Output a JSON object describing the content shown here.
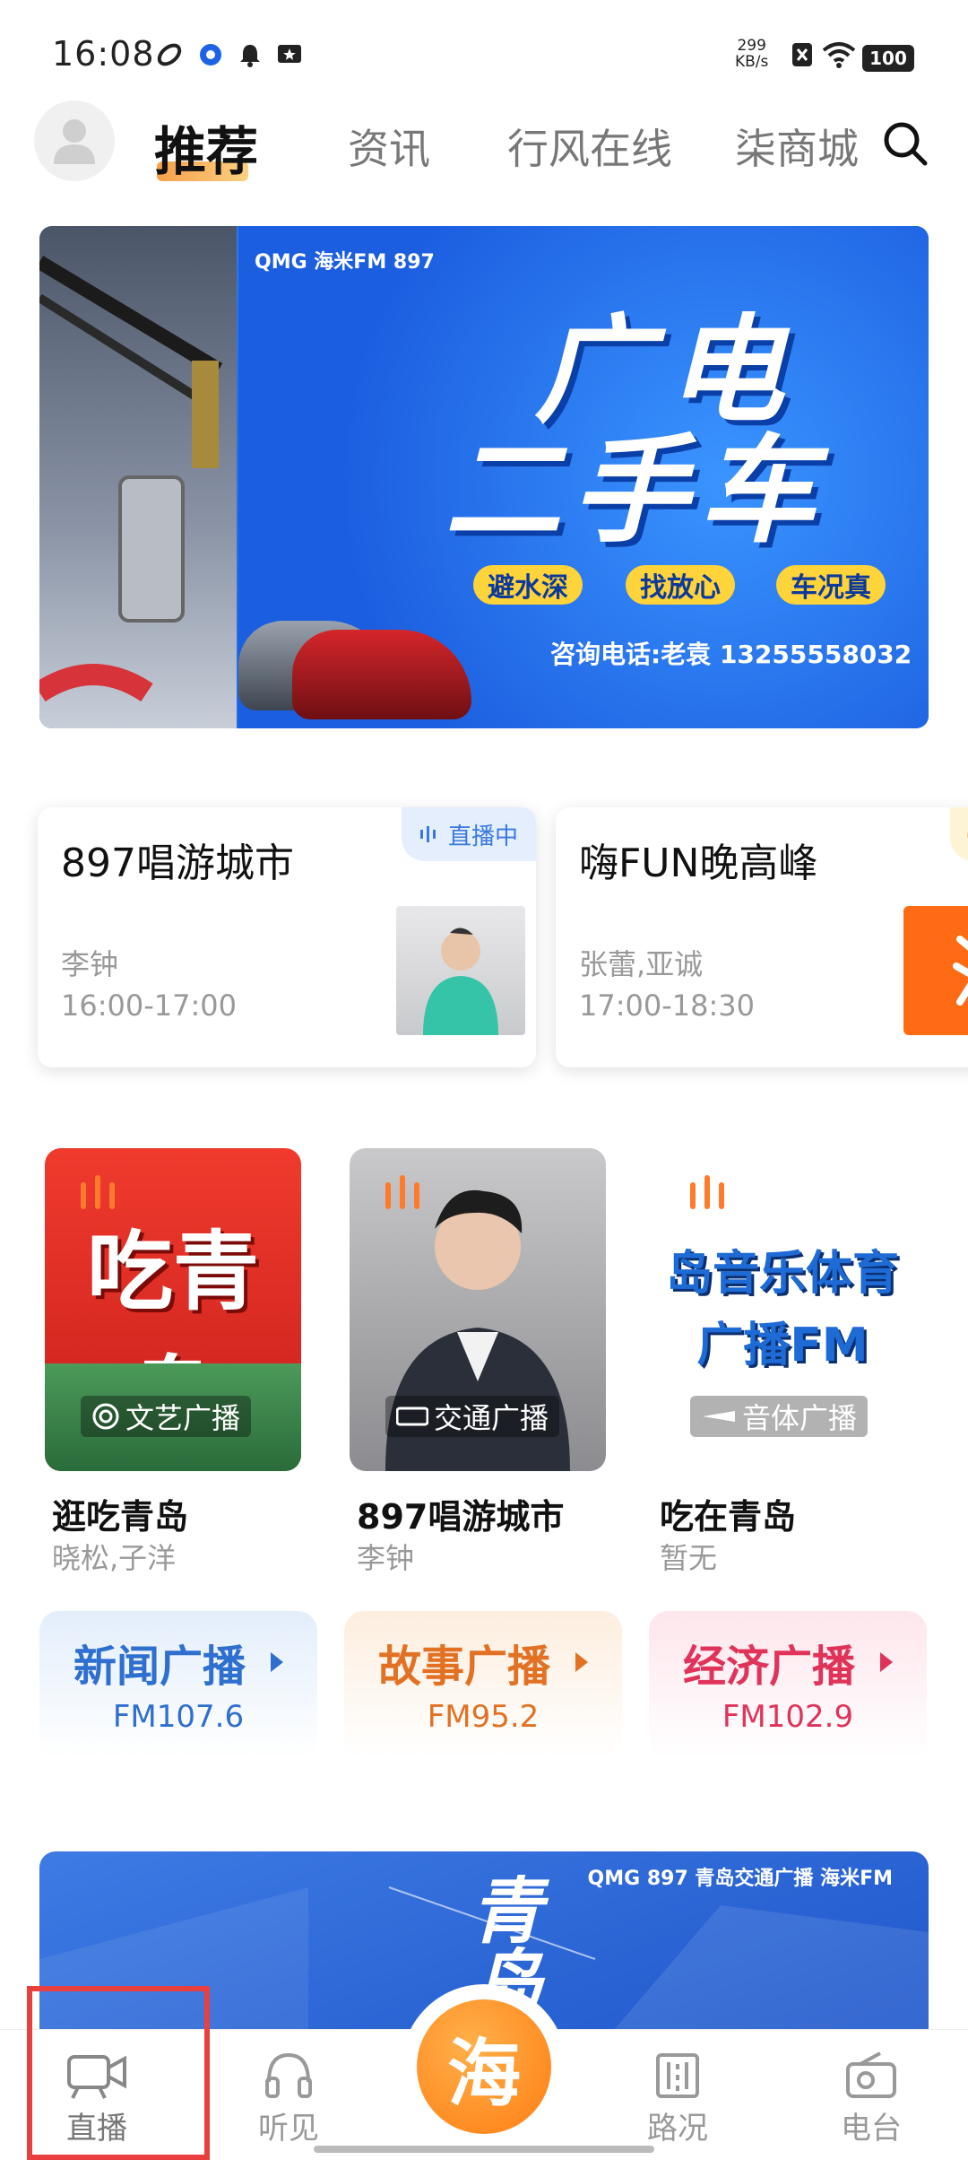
{
  "status_bar": {
    "time": "16:08",
    "net_speed": "299",
    "net_unit": "KB/s",
    "battery": "100"
  },
  "top_tabs": [
    {
      "label": "推荐",
      "active": true
    },
    {
      "label": "资讯",
      "active": false
    },
    {
      "label": "行风在线",
      "active": false
    },
    {
      "label": "柒商城",
      "active": false
    }
  ],
  "banner": {
    "logos": "QMG 海米FM 897",
    "title_line1": "广电",
    "title_line2": "二手车",
    "pills": [
      "避水深",
      "找放心",
      "车况真"
    ],
    "phone": "咨询电话:老袁 13255558032",
    "slide_count": 7,
    "active_slide": 6
  },
  "programs": [
    {
      "title": "897唱游城市",
      "host": "李钟",
      "time": "16:00-17:00",
      "badge": "直播中"
    },
    {
      "title": "嗨FUN晚高峰",
      "host": "张蕾,亚诚",
      "time": "17:00-18:30",
      "badge": ""
    }
  ],
  "recommend": [
    {
      "title": "逛吃青岛",
      "sub": "晓松,子洋",
      "channel": "文艺广播",
      "art": "吃青岛"
    },
    {
      "title": "897唱游城市",
      "sub": "李钟",
      "channel": "交通广播",
      "art": ""
    },
    {
      "title": "吃在青岛",
      "sub": "暂无",
      "channel": "音体广播",
      "art": "岛音乐体育 广播FM"
    }
  ],
  "stations": [
    {
      "name": "新闻广播",
      "freq": "FM107.6",
      "color": "#2e6fcf",
      "bg": "#e3eefb"
    },
    {
      "name": "故事广播",
      "freq": "FM95.2",
      "color": "#e27123",
      "bg": "#fdeedf"
    },
    {
      "name": "经济广播",
      "freq": "FM102.9",
      "color": "#e0335a",
      "bg": "#fde6ec"
    }
  ],
  "bottom_banner": {
    "logos": "QMG 897 青岛交通广播 海米FM",
    "title": "青岛"
  },
  "nav": [
    {
      "label": "直播",
      "icon": "camera-icon",
      "active": true
    },
    {
      "label": "听见",
      "icon": "headphones-icon",
      "active": false
    },
    {
      "label": "海",
      "icon": "hai-logo",
      "active": false
    },
    {
      "label": "路况",
      "icon": "road-icon",
      "active": false
    },
    {
      "label": "电台",
      "icon": "radio-icon",
      "active": false
    }
  ]
}
